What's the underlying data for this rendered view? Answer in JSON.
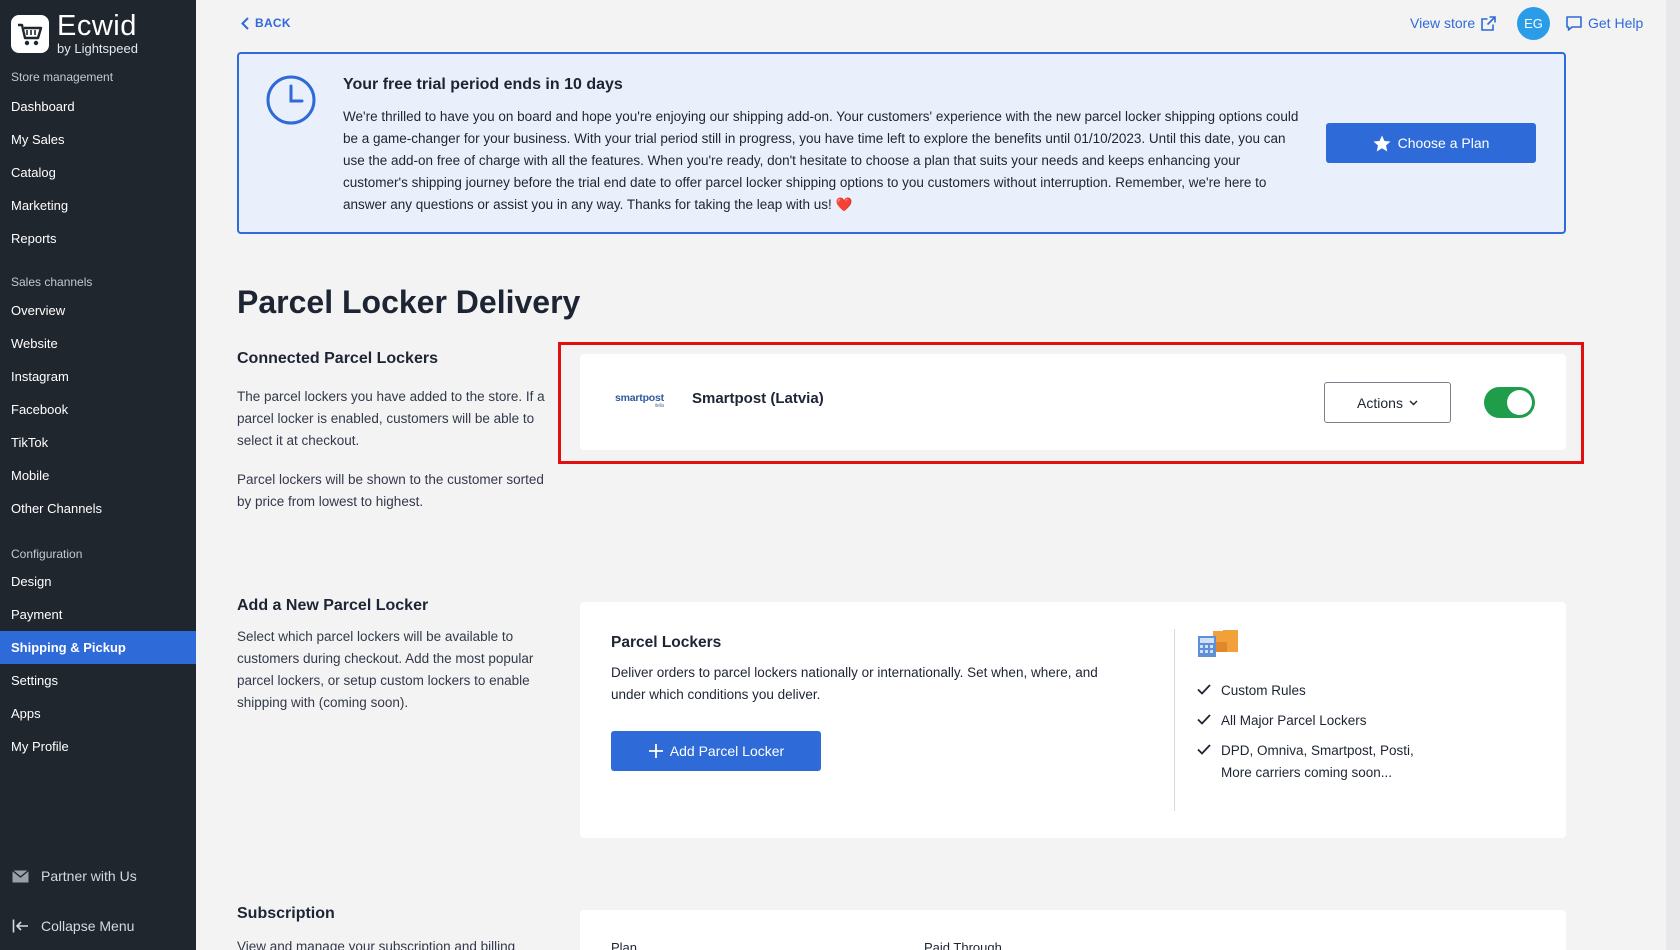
{
  "brand": {
    "name": "Ecwid",
    "sub": "by Lightspeed"
  },
  "sidebar": {
    "sections": [
      "Store management",
      "Sales channels",
      "Configuration"
    ],
    "store_items": [
      "Dashboard",
      "My Sales",
      "Catalog",
      "Marketing",
      "Reports"
    ],
    "channel_items": [
      "Overview",
      "Website",
      "Instagram",
      "Facebook",
      "TikTok",
      "Mobile",
      "Other Channels"
    ],
    "config_items": [
      "Design",
      "Payment",
      "Shipping & Pickup",
      "Settings",
      "Apps",
      "My Profile"
    ],
    "active_item": "Shipping & Pickup",
    "partner": "Partner with Us",
    "collapse": "Collapse Menu"
  },
  "topbar": {
    "back": "BACK",
    "view_store": "View store",
    "avatar": "EG",
    "get_help": "Get Help"
  },
  "banner": {
    "title": "Your free trial period ends in 10 days",
    "text": "We're thrilled to have you on board and hope you're enjoying our shipping add-on. Your customers' experience with the new parcel locker shipping options could be a game-changer for your business. With your trial period still in progress, you have time left to explore the benefits until 01/10/2023. Until this date, you can use the add-on free of charge with all the features. When you're ready, don't hesitate to choose a plan that suits your needs and keeps enhancing your customer's shipping journey before the trial end date to offer parcel locker shipping options to you customers without interruption. Remember, we're here to answer any questions or assist you in any way. Thanks for taking the leap with us!",
    "heart": "❤️",
    "button": "Choose a Plan"
  },
  "page": {
    "title": "Parcel Locker Delivery"
  },
  "connected": {
    "title": "Connected Parcel Lockers",
    "text1": "The parcel lockers you have added to the store. If a parcel locker is enabled, customers will be able to select it at checkout.",
    "text2": "Parcel lockers will be shown to the customer sorted by price from lowest to highest.",
    "locker": {
      "logo": "smartpost",
      "logo_sub": "itella",
      "name": "Smartpost (Latvia)",
      "actions": "Actions",
      "enabled": true
    }
  },
  "add_new": {
    "title": "Add a New Parcel Locker",
    "text": "Select which parcel lockers will be available to customers during checkout. Add the most popular parcel lockers, or setup custom lockers to enable shipping with (coming soon).",
    "card_title": "Parcel Lockers",
    "card_text": "Deliver orders to parcel lockers nationally or internationally. Set when, where, and under which conditions you deliver.",
    "button": "Add Parcel Locker",
    "features": [
      "Custom Rules",
      "All Major Parcel Lockers",
      "DPD, Omniva, Smartpost, Posti, More carriers coming soon..."
    ]
  },
  "subscription": {
    "title": "Subscription",
    "text": "View and manage your subscription and billing",
    "col_plan": "Plan",
    "col_paid": "Paid Through"
  },
  "colors": {
    "accent": "#2f6ad9",
    "sidebar": "#20262e",
    "toggle_on": "#1f9d4a",
    "highlight": "#e10f0f"
  }
}
